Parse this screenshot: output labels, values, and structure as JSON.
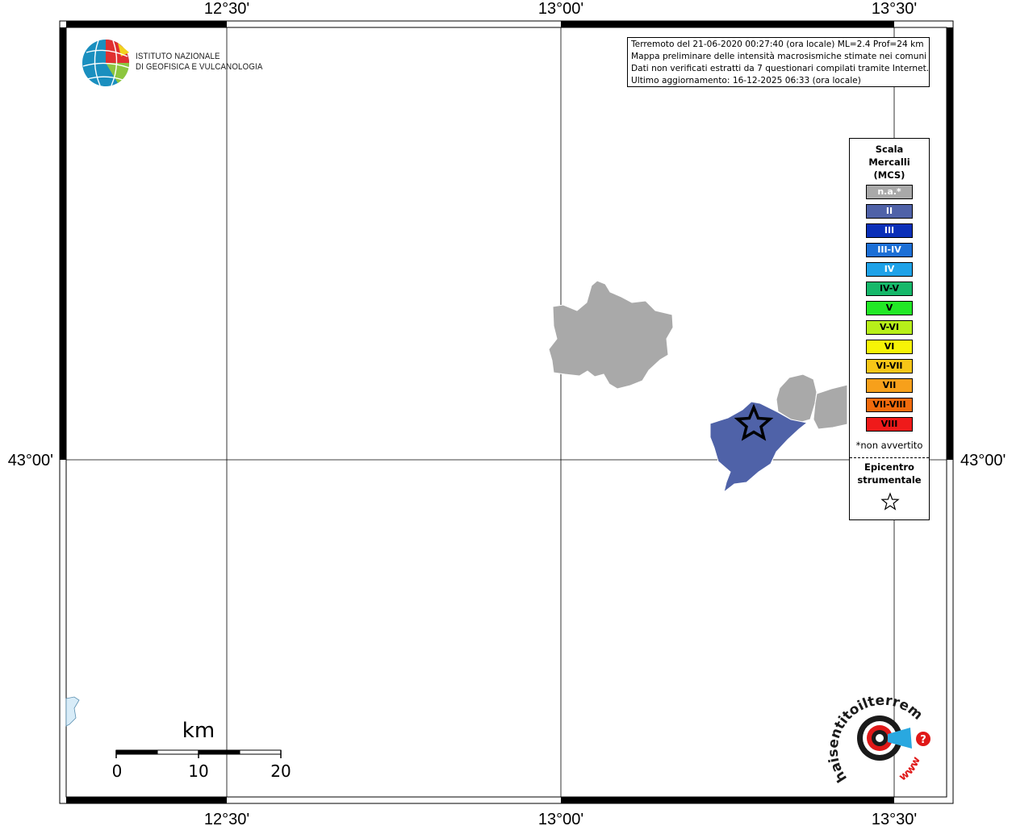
{
  "map": {
    "lon_labels": [
      "12°30'",
      "13°00'",
      "13°30'"
    ],
    "lat_label": "43°00'"
  },
  "info": {
    "line1": "Terremoto del 21-06-2020 00:27:40 (ora locale) ML=2.4 Prof=24 km",
    "line2": "Mappa preliminare delle intensità macrosismiche stimate nei comuni",
    "line3": "Dati non verificati estratti da 7 questionari compilati tramite Internet.",
    "line4": "Ultimo aggiornamento: 16-12-2025 06:33 (ora locale)"
  },
  "logo": {
    "line1": "ISTITUTO NAZIONALE",
    "line2": "DI GEOFISICA E VULCANOLOGIA"
  },
  "legend": {
    "title1": "Scala",
    "title2": "Mercalli",
    "title3": "(MCS)",
    "items": [
      {
        "label": "n.a.*",
        "color": "#a9a9a9",
        "text": "#ffffff"
      },
      {
        "label": "II",
        "color": "#4f62a8",
        "text": "#ffffff"
      },
      {
        "label": "III",
        "color": "#0a2fb8",
        "text": "#ffffff"
      },
      {
        "label": "III-IV",
        "color": "#1c6fd6",
        "text": "#ffffff"
      },
      {
        "label": "IV",
        "color": "#1ea2e8",
        "text": "#ffffff"
      },
      {
        "label": "IV-V",
        "color": "#16b86a",
        "text": "#000000"
      },
      {
        "label": "V",
        "color": "#22e826",
        "text": "#000000"
      },
      {
        "label": "V-VI",
        "color": "#b7ef1a",
        "text": "#000000"
      },
      {
        "label": "VI",
        "color": "#f7f406",
        "text": "#000000"
      },
      {
        "label": "VI-VII",
        "color": "#f7c617",
        "text": "#000000"
      },
      {
        "label": "VII",
        "color": "#f7a01b",
        "text": "#000000"
      },
      {
        "label": "VII-VIII",
        "color": "#f26b0c",
        "text": "#000000"
      },
      {
        "label": "VIII",
        "color": "#ef1a1a",
        "text": "#000000"
      }
    ],
    "note": "*non avvertito",
    "epi1": "Epicentro",
    "epi2": "strumentale"
  },
  "scale": {
    "unit": "km",
    "ticks": [
      "0",
      "10",
      "20"
    ]
  },
  "brand": {
    "text": "haisentitoilterremoto.it",
    "www": "www."
  },
  "colors": {
    "na": "#a9a9a9",
    "intensity_ii": "#4f62a8",
    "water": "#d8ecf8"
  }
}
